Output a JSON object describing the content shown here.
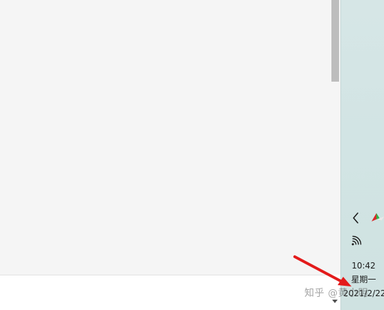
{
  "taskbar": {
    "clock": {
      "time": "10:42",
      "day": "星期一",
      "date": "2021/2/22"
    }
  },
  "watermark": {
    "text": "知乎 @黄小明"
  },
  "icons": {
    "overflow": "chevron-left-icon",
    "app": "app-tray-icon",
    "network": "wifi-icon",
    "scroll_down": "chevron-down-icon"
  },
  "colors": {
    "annotation_arrow": "#e31b1b",
    "taskbar_bg": "#d2e4e4",
    "content_bg": "#f5f5f5",
    "scrollbar_thumb": "#bdbdbd"
  }
}
